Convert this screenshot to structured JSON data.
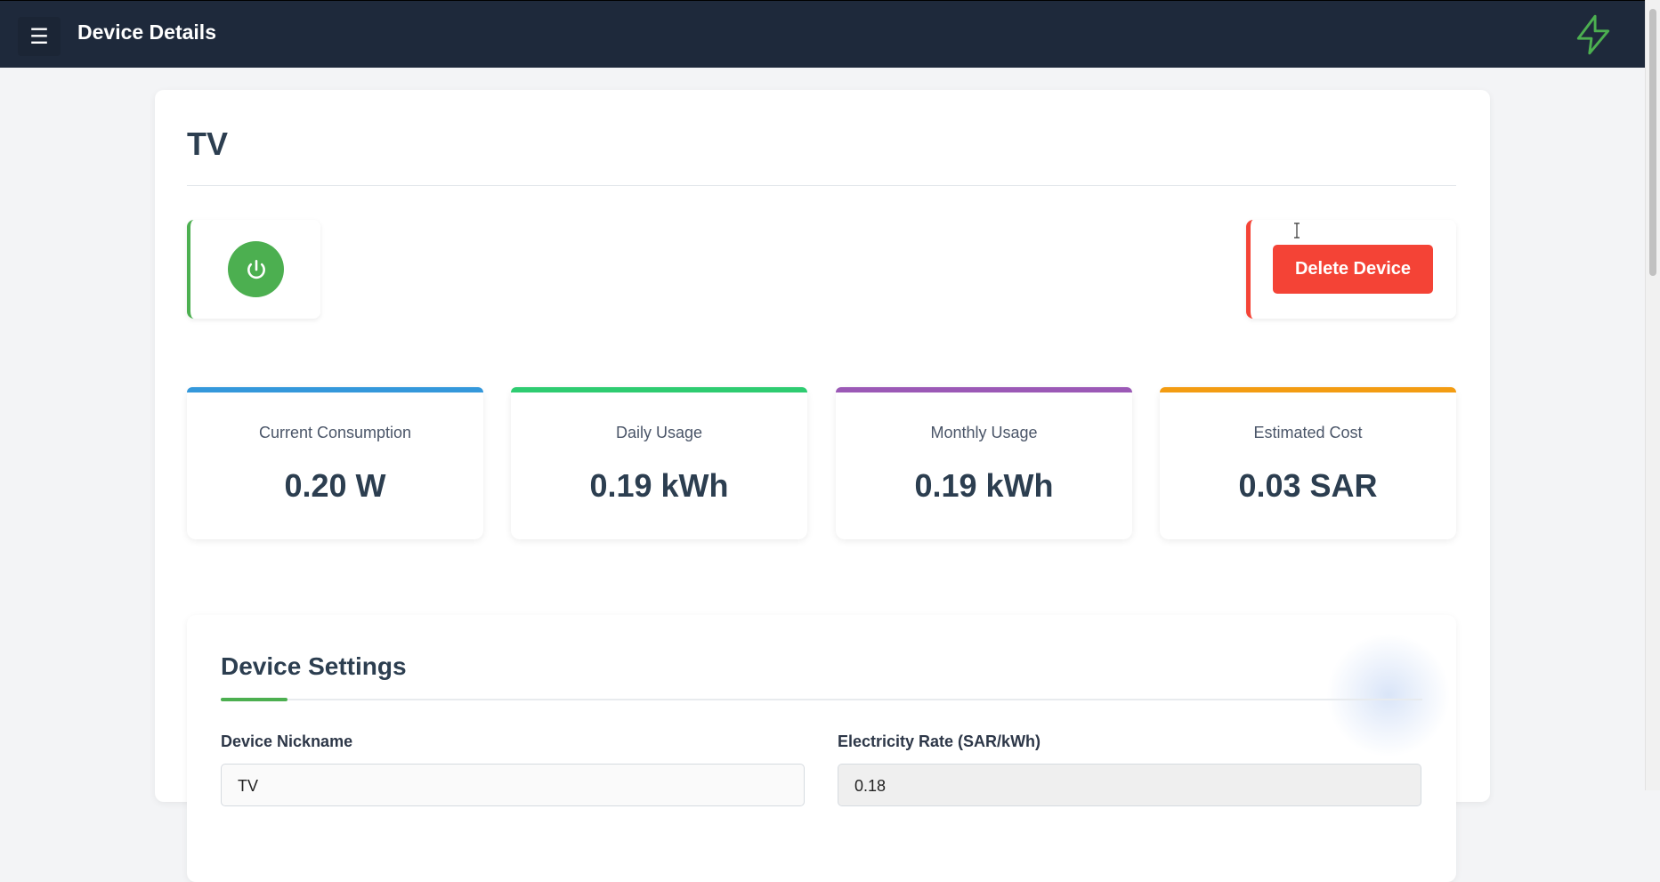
{
  "header": {
    "menu_icon": "☰",
    "title": "Device Details",
    "logo_icon": "lightning-bolt",
    "accent_color": "#4caf50",
    "bg_color": "#1e293b"
  },
  "device": {
    "name": "TV",
    "power_status": "on",
    "delete_label": "Delete Device"
  },
  "stats": [
    {
      "label": "Current Consumption",
      "value": "0.20 W",
      "color": "#3498db"
    },
    {
      "label": "Daily Usage",
      "value": "0.19 kWh",
      "color": "#2ecc71"
    },
    {
      "label": "Monthly Usage",
      "value": "0.19 kWh",
      "color": "#9b59b6"
    },
    {
      "label": "Estimated Cost",
      "value": "0.03 SAR",
      "color": "#f39c12"
    }
  ],
  "settings": {
    "title": "Device Settings",
    "nickname_label": "Device Nickname",
    "nickname_value": "TV",
    "rate_label": "Electricity Rate (SAR/kWh)",
    "rate_value": "0.18"
  }
}
